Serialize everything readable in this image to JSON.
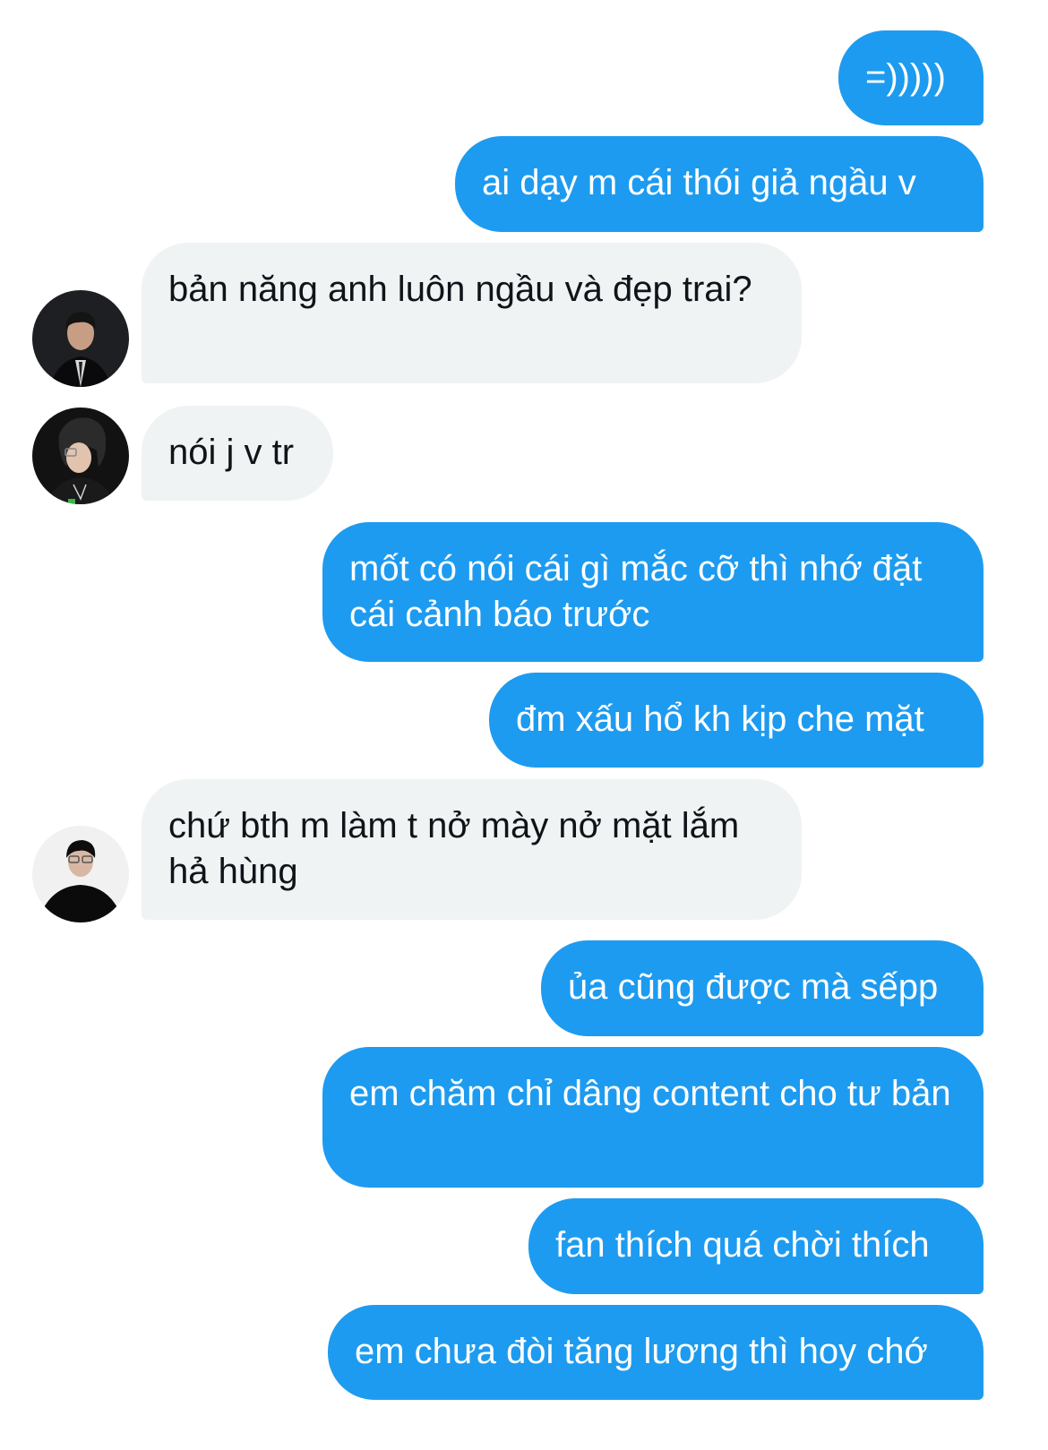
{
  "messages": [
    {
      "sender": "me",
      "text": "=)))))"
    },
    {
      "sender": "me",
      "text": "ai dạy m cái thói giả ngầu v"
    },
    {
      "sender": "other",
      "text": "bản năng anh luôn ngầu và đẹp trai?"
    },
    {
      "sender": "other",
      "text": "nói j v tr"
    },
    {
      "sender": "me",
      "text": "mốt có nói cái gì mắc cỡ thì nhớ đặt cái cảnh báo trước"
    },
    {
      "sender": "me",
      "text": "đm xấu hổ kh kịp che mặt"
    },
    {
      "sender": "other",
      "text": "chứ bth m làm t nở mày nở mặt lắm hả hùng"
    },
    {
      "sender": "me",
      "text": "ủa cũng được mà sếpp"
    },
    {
      "sender": "me",
      "text": "em chăm chỉ dâng content cho tư bản"
    },
    {
      "sender": "me",
      "text": "fan thích quá chời thích"
    },
    {
      "sender": "me",
      "text": "em chưa đòi tăng lương thì hoy chớ"
    }
  ],
  "colors": {
    "outgoing_bubble": "#1d9bf0",
    "incoming_bubble": "#eff3f4",
    "outgoing_text": "#ffffff",
    "incoming_text": "#0f1419"
  }
}
